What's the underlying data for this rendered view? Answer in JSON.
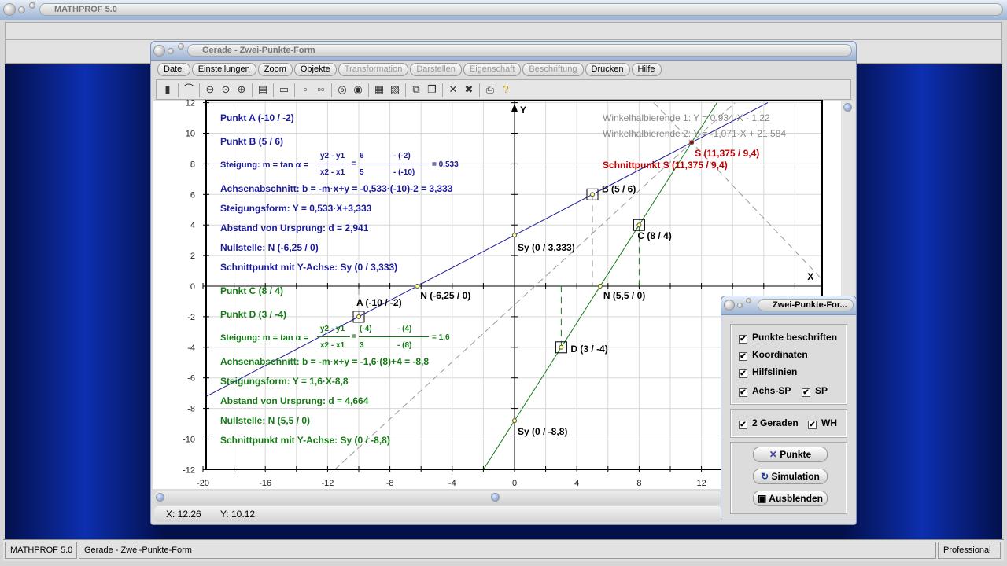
{
  "app": {
    "title": "MATHPROF 5.0"
  },
  "window": {
    "title": "Gerade - Zwei-Punkte-Form"
  },
  "menu": [
    {
      "label": "Datei",
      "enabled": true
    },
    {
      "label": "Einstellungen",
      "enabled": true
    },
    {
      "label": "Zoom",
      "enabled": true
    },
    {
      "label": "Objekte",
      "enabled": true
    },
    {
      "label": "Transformation",
      "enabled": false
    },
    {
      "label": "Darstellen",
      "enabled": false
    },
    {
      "label": "Eigenschaft",
      "enabled": false
    },
    {
      "label": "Beschriftung",
      "enabled": false
    },
    {
      "label": "Drucken",
      "enabled": true
    },
    {
      "label": "Hilfe",
      "enabled": true
    }
  ],
  "toolbar_icons": [
    "panel-icon",
    "glasses-icon",
    "zoom-out-icon",
    "zoom-reset-icon",
    "zoom-in-icon",
    "properties-icon",
    "window-icon",
    "single-view-icon",
    "double-view-icon",
    "option1-icon",
    "option2-icon",
    "table-icon",
    "export-icon",
    "copy-icon",
    "pages-icon",
    "clear-points-icon",
    "clear-all-icon",
    "print-icon",
    "help-icon"
  ],
  "info1": {
    "punkt_a": "Punkt A (-10 / -2)",
    "punkt_b": "Punkt B (5 / 6)",
    "steigung": "Steigung: m = tan  α =",
    "num": "y2 - y1",
    "den": "x2 - x1",
    "num2a": "6",
    "num2b": "- (-2)",
    "den2a": "5",
    "den2b": "- (-10)",
    "result": "= 0,533",
    "achsen": "Achsenabschnitt: b = -m·x+y = -0,533·(-10)-2 = 3,333",
    "form": "Steigungsform: Y = 0,533·X+3,333",
    "abstand": "Abstand von Ursprung: d = 2,941",
    "null": "Nullstelle: N (-6,25 / 0)",
    "schnitt": "Schnittpunkt mit Y-Achse: Sy (0 / 3,333)"
  },
  "info2": {
    "punkt_c": "Punkt C (8 / 4)",
    "punkt_d": "Punkt D (3 / -4)",
    "steigung": "Steigung: m = tan  α =",
    "num": "y2 - y1",
    "den": "x2 - x1",
    "num2a": "(-4)",
    "num2b": "- (4)",
    "den2a": "3",
    "den2b": "- (8)",
    "result": "= 1,6",
    "achsen": "Achsenabschnitt: b = -m·x+y = -1,6·(8)+4 = -8,8",
    "form": "Steigungsform: Y = 1,6·X-8,8",
    "abstand": "Abstand von Ursprung: d = 4,664",
    "null": "Nullstelle: N (5,5 / 0)",
    "schnitt": "Schnittpunkt mit Y-Achse: Sy (0 / -8,8)"
  },
  "bisectors": {
    "wh1": "Winkelhalbierende 1: Y = 0,934·X - 1,22",
    "wh2": "Winkelhalbierende 2: Y = -1,071·X + 21,584",
    "s_label": "Schnittpunkt S (11,375 / 9,4)"
  },
  "chart_data": {
    "type": "line",
    "xlim": [
      -20,
      19.7
    ],
    "ylim": [
      -12,
      12
    ],
    "grid": true,
    "xticks": [
      "-20",
      "-16",
      "-12",
      "-8",
      "-4",
      "0",
      "4",
      "8",
      "12"
    ],
    "yticks": [
      "12",
      "10",
      "8",
      "6",
      "4",
      "2",
      "0",
      "-2",
      "-4",
      "-6",
      "-8",
      "-10",
      "-12"
    ],
    "xlabel": "X",
    "ylabel": "Y",
    "series": [
      {
        "slope": 0.533,
        "intercept": 3.333,
        "color": "#1a1a9a",
        "style": "solid"
      },
      {
        "slope": 1.6,
        "intercept": -8.8,
        "color": "#167a16",
        "style": "solid"
      },
      {
        "slope": 0.934,
        "intercept": -1.22,
        "color": "#9a9a9a",
        "style": "dashed"
      },
      {
        "slope": -1.071,
        "intercept": 21.584,
        "color": "#9a9a9a",
        "style": "dashed"
      }
    ],
    "points": [
      {
        "label": "A (-10 / -2)",
        "x": -10,
        "y": -2,
        "marker": "square",
        "color": "#000000"
      },
      {
        "label": "B (5 / 6)",
        "x": 5,
        "y": 6,
        "marker": "square",
        "color": "#000000"
      },
      {
        "label": "C (8 / 4)",
        "x": 8,
        "y": 4,
        "marker": "square",
        "color": "#000000"
      },
      {
        "label": "D (3 / -4)",
        "x": 3,
        "y": -4,
        "marker": "square",
        "color": "#000000"
      },
      {
        "label": "N (-6,25 / 0)",
        "x": -6.25,
        "y": 0,
        "marker": "dot",
        "color": "#000000"
      },
      {
        "label": "Sy (0 / 3,333)",
        "x": 0,
        "y": 3.333,
        "marker": "dot",
        "color": "#000000"
      },
      {
        "label": "N (5,5 / 0)",
        "x": 5.5,
        "y": 0,
        "marker": "dot",
        "color": "#000000"
      },
      {
        "label": "Sy (0 / -8,8)",
        "x": 0,
        "y": -8.8,
        "marker": "dot",
        "color": "#000000"
      },
      {
        "label": "S (11,375 / 9,4)",
        "x": 11.375,
        "y": 9.4,
        "marker": "dot",
        "color": "#c00000"
      }
    ]
  },
  "coords": {
    "x": "X: 12.26",
    "y": "Y: 10.12"
  },
  "dialog": {
    "title": "Zwei-Punkte-For...",
    "punkte_beschriften": "Punkte beschriften",
    "koordinaten": "Koordinaten",
    "hilfslinien": "Hilfslinien",
    "achs_sp": "Achs-SP",
    "sp": "SP",
    "zwei_geraden": "2 Geraden",
    "wh": "WH",
    "checked": {
      "punkte_beschriften": true,
      "koordinaten": true,
      "hilfslinien": true,
      "achs_sp": true,
      "sp": true,
      "zwei_geraden": true,
      "wh": true
    },
    "btn_punkte": "Punkte",
    "btn_simulation": "Simulation",
    "btn_ausblenden": "Ausblenden"
  },
  "statusbar": {
    "app": "MATHPROF 5.0",
    "doc": "Gerade - Zwei-Punkte-Form",
    "edition": "Professional"
  }
}
